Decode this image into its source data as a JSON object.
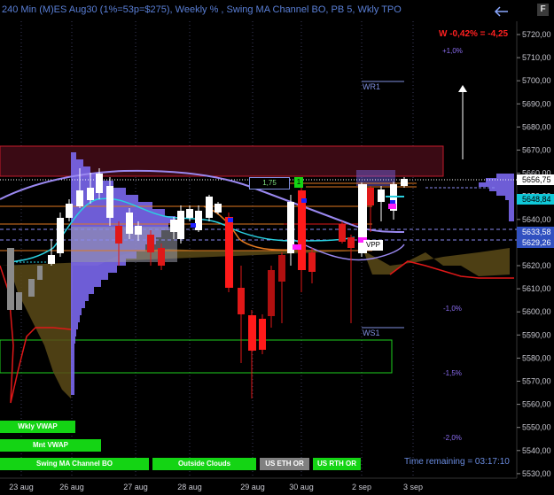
{
  "window": {
    "title": "240 Min (M)ES Aug30  (1%=53p=$275), Weekly % , Swing MA Channel BO, PB 5, Wkly TPO",
    "corner_label": "F"
  },
  "price_axis": {
    "ticks": [
      "5720,00",
      "5710,00",
      "5700,00",
      "5690,00",
      "5680,00",
      "5670,00",
      "5660,00",
      "5650,00",
      "5640,00",
      "5630,00",
      "5620,00",
      "5610,00",
      "5600,00",
      "5590,00",
      "5580,00",
      "5570,00",
      "5560,00",
      "5550,00",
      "5540,00",
      "5530,00"
    ],
    "current_price": "5656,75",
    "tag_cyan": "5648,84",
    "tag_blue1": "5633,58",
    "tag_blue2": "5629,26"
  },
  "date_axis": {
    "labels": [
      "23 aug",
      "26 aug",
      "27 aug",
      "28 aug",
      "29 aug",
      "30 aug",
      "2 sep",
      "3 sep"
    ]
  },
  "annotations": {
    "weekly_change": "W -0,42% = -4,25",
    "pct_plus1": "+1,0%",
    "pct_minus1": "-1,0%",
    "pct_minus15": "-1,5%",
    "pct_minus2": "-2,0%",
    "wr1": "WR1",
    "ws1": "WS1",
    "vpp": "VPP",
    "swing_value": "1,75",
    "swing_marker": "1"
  },
  "buttons": {
    "wkly_vwap": "Wkly VWAP",
    "mnt_vwap": "Mnt VWAP",
    "swing_ma": "Swing MA Channel BO",
    "outside_clouds": "Outside Clouds",
    "us_eth_or": "US ETH OR",
    "us_rth_or": "US RTH OR"
  },
  "status": {
    "time_remaining": "Time remaining = 03:17:10"
  },
  "colors": {
    "background": "#000000",
    "up_candle": "#ffffff",
    "down_candle": "#ff1a1a",
    "tpo_profile": "#7b68ee",
    "cloud": "#6b5a1e",
    "green_button": "#14d414",
    "grey_button": "#808080",
    "title_blue": "#5a7fd6"
  }
}
